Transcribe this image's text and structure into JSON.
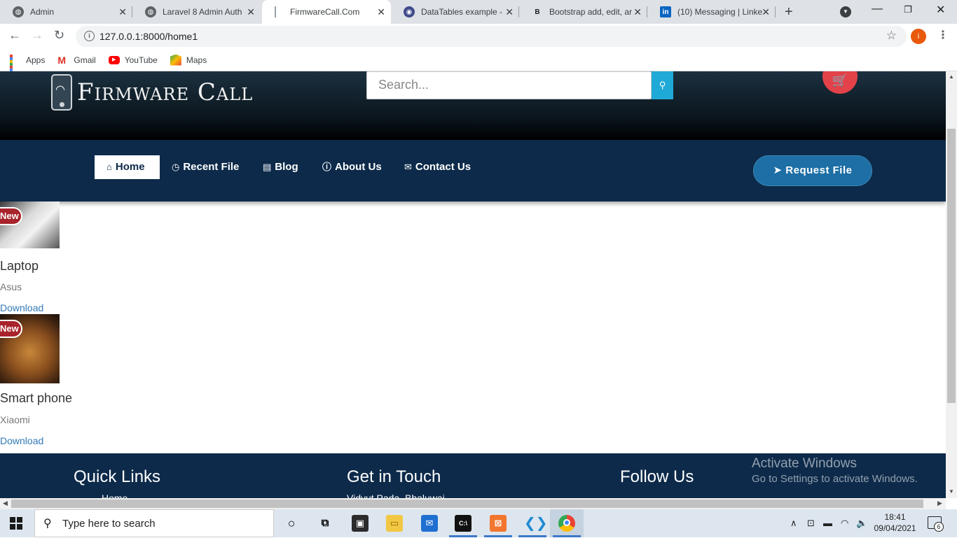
{
  "browser": {
    "tabs": [
      {
        "label": "Admin",
        "icon": "globe-icon"
      },
      {
        "label": "Laravel 8 Admin Auth",
        "icon": "globe-icon"
      },
      {
        "label": "FirmwareCall.Com",
        "icon": "loading-icon",
        "active": true
      },
      {
        "label": "DataTables example - ",
        "icon": "datatables-icon"
      },
      {
        "label": "Bootstrap add, edit, ar",
        "icon": "bootstrap-icon"
      },
      {
        "label": "(10) Messaging | Linke",
        "icon": "linkedin-icon"
      }
    ],
    "new_tab": "+",
    "url": "127.0.0.1:8000/home1",
    "profile_initial": "i",
    "bookmarks": [
      "Apps",
      "Gmail",
      "YouTube",
      "Maps"
    ]
  },
  "site": {
    "logo_text": "Firmware Call",
    "search_placeholder": "Search...",
    "nav": [
      {
        "label": "Home",
        "icon": "home-icon",
        "active": true
      },
      {
        "label": "Recent File",
        "icon": "clock-icon"
      },
      {
        "label": "Blog",
        "icon": "file-icon"
      },
      {
        "label": "About Us",
        "icon": "info-icon"
      },
      {
        "label": "Contact Us",
        "icon": "envelope-icon"
      }
    ],
    "request_button": "Request File",
    "products": [
      {
        "badge": "New",
        "title": "Laptop",
        "brand": "Asus",
        "link": "Download",
        "thumb": "notebook-photo"
      },
      {
        "badge": "New",
        "title": "Smart phone",
        "brand": "Xiaomi",
        "link": "Download",
        "thumb": "lion-photo"
      }
    ],
    "footer": {
      "quick_links": "Quick Links",
      "get_in_touch": "Get in Touch",
      "follow_us": "Follow Us",
      "quick_first": "Home",
      "touch_first": "Vidyut Pada, Bhaluwaj"
    }
  },
  "os": {
    "watermark_title": "Activate Windows",
    "watermark_sub": "Go to Settings to activate Windows.",
    "search_text": "Type here to search",
    "time": "18:41",
    "date": "09/04/2021",
    "notifications": "6"
  },
  "colors": {
    "header_dark": "#0a141b",
    "navbar": "#0d2a4a",
    "accent_search": "#1fa9d6",
    "cart_red": "#e3424a",
    "badge_red": "#a8232b",
    "link_blue": "#337ab7"
  }
}
